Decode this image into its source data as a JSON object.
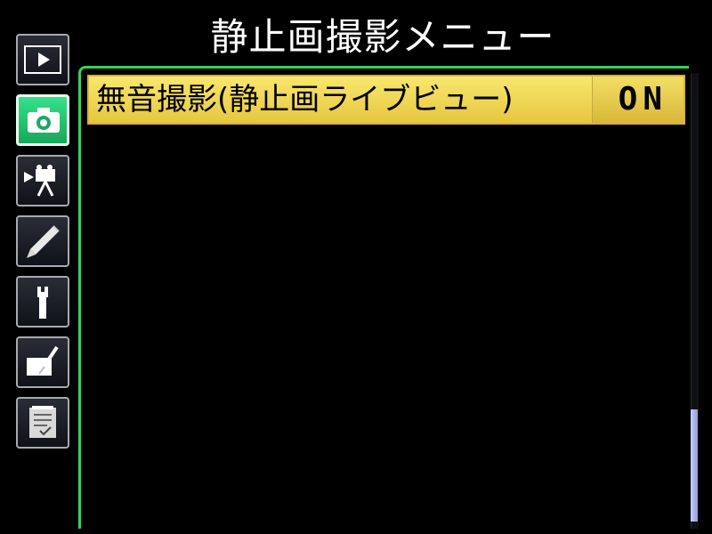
{
  "header": {
    "title": "静止画撮影メニュー"
  },
  "sidebar": {
    "tabs": [
      {
        "name": "playback"
      },
      {
        "name": "shooting",
        "active": true
      },
      {
        "name": "movie"
      },
      {
        "name": "custom-settings"
      },
      {
        "name": "setup"
      },
      {
        "name": "retouch"
      },
      {
        "name": "my-menu"
      }
    ]
  },
  "menu": {
    "items": [
      {
        "label": "無音撮影(静止画ライブビュー)",
        "value": "ON"
      }
    ]
  },
  "colors": {
    "active_tab": "#24c06c",
    "highlight": "#f5df66",
    "panel_border": "#34d15f"
  }
}
